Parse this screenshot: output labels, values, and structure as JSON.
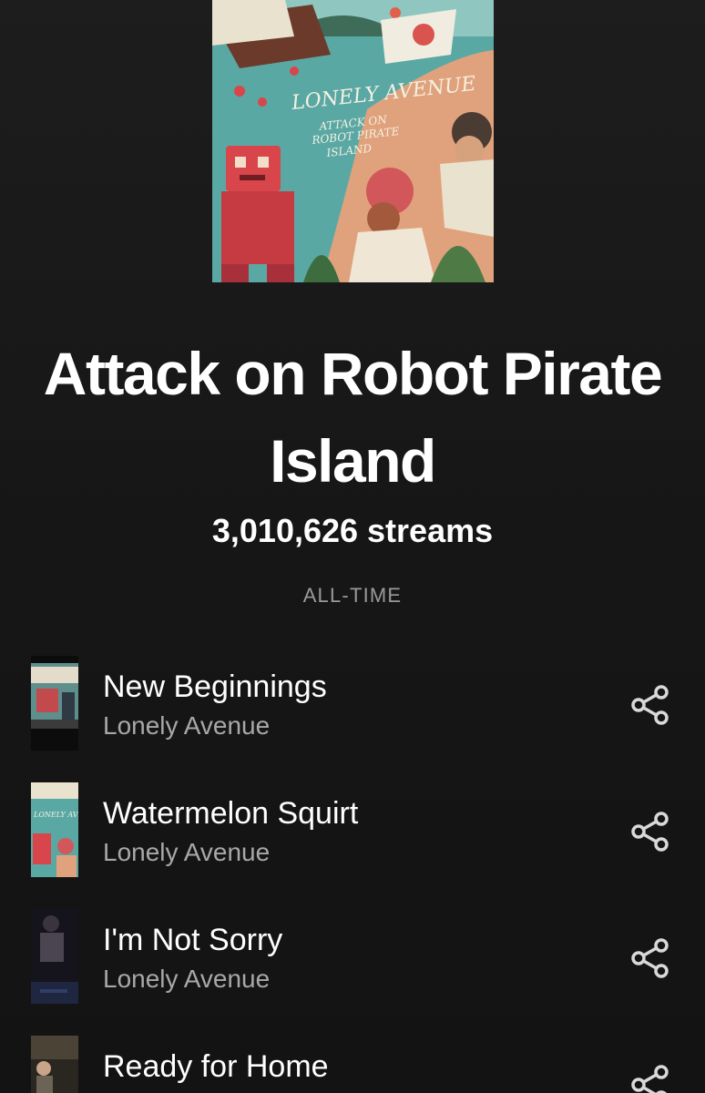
{
  "album": {
    "title": "Attack on Robot Pirate Island",
    "streams": "3,010,626 streams",
    "period": "ALL-TIME",
    "cover_icon": "album-cover-art"
  },
  "tracks": [
    {
      "name": "New Beginnings",
      "artist": "Lonely Avenue"
    },
    {
      "name": "Watermelon Squirt",
      "artist": "Lonely Avenue"
    },
    {
      "name": "I'm Not Sorry",
      "artist": "Lonely Avenue"
    },
    {
      "name": "Ready for Home",
      "artist": ""
    }
  ],
  "colors": {
    "background": "#161616",
    "text_primary": "#ffffff",
    "text_secondary": "#a8a8a8",
    "period_label": "#9a9a9a"
  },
  "icons": {
    "share": "share-icon"
  }
}
